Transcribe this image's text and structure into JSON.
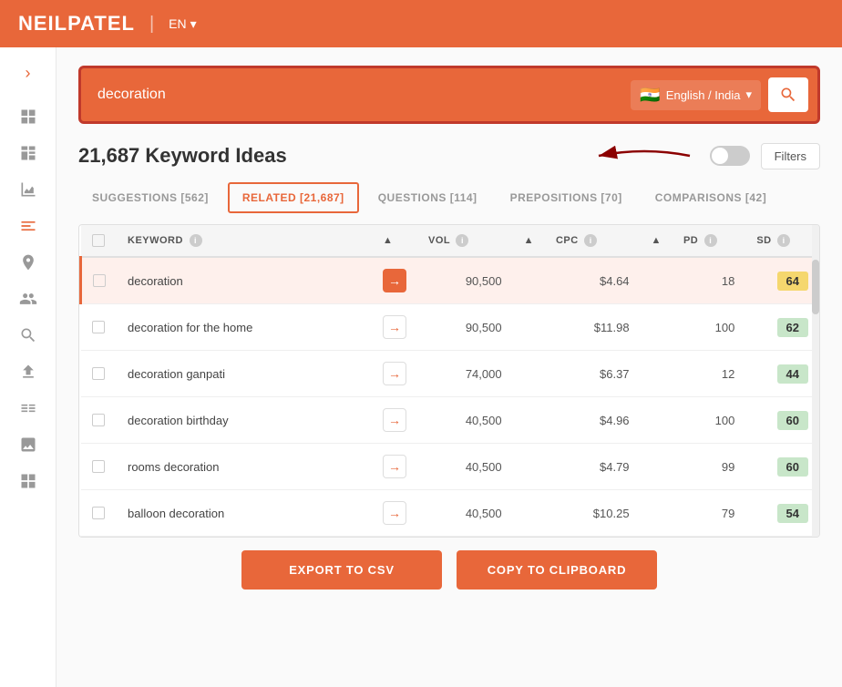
{
  "header": {
    "logo": "NEILPATEL",
    "lang": "EN",
    "lang_chevron": "▾"
  },
  "search": {
    "query": "decoration",
    "lang_selector": "English / India",
    "flag": "🇮🇳",
    "search_icon": "🔍"
  },
  "keywords": {
    "title": "21,687 Keyword Ideas",
    "filters_label": "Filters"
  },
  "tabs": [
    {
      "id": "suggestions",
      "label": "SUGGESTIONS [562]",
      "active": false
    },
    {
      "id": "related",
      "label": "RELATED [21,687]",
      "active": true
    },
    {
      "id": "questions",
      "label": "QUESTIONS [114]",
      "active": false
    },
    {
      "id": "prepositions",
      "label": "PREPOSITIONS [70]",
      "active": false
    },
    {
      "id": "comparisons",
      "label": "COMPARISONS [42]",
      "active": false
    }
  ],
  "table": {
    "columns": [
      {
        "id": "checkbox",
        "label": ""
      },
      {
        "id": "keyword",
        "label": "KEYWORD"
      },
      {
        "id": "icon",
        "label": ""
      },
      {
        "id": "vol",
        "label": "VOL"
      },
      {
        "id": "sort1",
        "label": ""
      },
      {
        "id": "cpc",
        "label": "CPC"
      },
      {
        "id": "sort2",
        "label": ""
      },
      {
        "id": "pd",
        "label": "PD"
      },
      {
        "id": "sd",
        "label": "SD"
      }
    ],
    "rows": [
      {
        "keyword": "decoration",
        "vol": "90,500",
        "cpc": "$4.64",
        "pd": "18",
        "sd": "64",
        "sd_color": "yellow",
        "highlighted": true
      },
      {
        "keyword": "decoration for the home",
        "vol": "90,500",
        "cpc": "$11.98",
        "pd": "100",
        "sd": "62",
        "sd_color": "green-light",
        "highlighted": false
      },
      {
        "keyword": "decoration ganpati",
        "vol": "74,000",
        "cpc": "$6.37",
        "pd": "12",
        "sd": "44",
        "sd_color": "green-light",
        "highlighted": false
      },
      {
        "keyword": "decoration birthday",
        "vol": "40,500",
        "cpc": "$4.96",
        "pd": "100",
        "sd": "60",
        "sd_color": "green-light",
        "highlighted": false
      },
      {
        "keyword": "rooms decoration",
        "vol": "40,500",
        "cpc": "$4.79",
        "pd": "99",
        "sd": "60",
        "sd_color": "green-light",
        "highlighted": false
      },
      {
        "keyword": "balloon decoration",
        "vol": "40,500",
        "cpc": "$10.25",
        "pd": "79",
        "sd": "54",
        "sd_color": "green-light",
        "highlighted": false
      }
    ]
  },
  "footer": {
    "export_csv": "EXPORT TO CSV",
    "copy_clipboard": "COPY TO CLIPBOARD"
  },
  "sidebar": {
    "items": [
      {
        "id": "toggle",
        "icon": "›"
      },
      {
        "id": "grid",
        "icon": "⊞"
      },
      {
        "id": "chart",
        "icon": "📊"
      },
      {
        "id": "analytics",
        "icon": "📈"
      },
      {
        "id": "keywords",
        "icon": "⊜"
      },
      {
        "id": "location",
        "icon": "📍"
      },
      {
        "id": "users",
        "icon": "👥"
      },
      {
        "id": "search2",
        "icon": "🔍"
      },
      {
        "id": "upload",
        "icon": "⬆"
      },
      {
        "id": "list",
        "icon": "☰"
      },
      {
        "id": "image",
        "icon": "🖼"
      },
      {
        "id": "grid2",
        "icon": "⊞"
      }
    ]
  }
}
